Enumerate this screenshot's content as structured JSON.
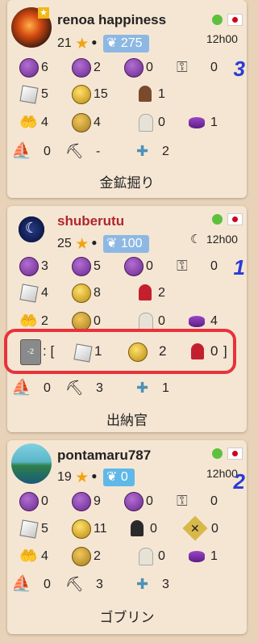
{
  "players": [
    {
      "name": "renoa happiness",
      "score": "21",
      "rank": "275",
      "clock": "12h00",
      "number": "3",
      "avatar": "fire-avatar",
      "rank_color": "#8db8e3",
      "resources": {
        "row1": [
          "6",
          "2",
          "0",
          "0"
        ],
        "row2": [
          "5",
          "15",
          "1"
        ],
        "row3": [
          "4",
          "4",
          "0",
          "1"
        ],
        "row4": [
          "0",
          "-",
          "2"
        ]
      },
      "role": "金鉱掘り"
    },
    {
      "name": "shuberutu",
      "score": "25",
      "rank": "100",
      "clock": "12h00",
      "number": "1",
      "avatar": "moon-avatar",
      "rank_color": "#8db8e3",
      "resources": {
        "row1": [
          "3",
          "5",
          "0",
          "0"
        ],
        "row2": [
          "4",
          "8",
          "2"
        ],
        "row3": [
          "2",
          "0",
          "0",
          "4"
        ],
        "row4": [
          "0",
          "3",
          "1"
        ]
      },
      "role": "出納官"
    },
    {
      "name": "pontamaru787",
      "score": "19",
      "rank": "0",
      "clock": "12h00",
      "number": "2",
      "avatar": "island-avatar",
      "rank_color": "#5fb8e8",
      "resources": {
        "row1": [
          "0",
          "9",
          "0",
          "0"
        ],
        "row2": [
          "5",
          "11",
          "0",
          "0"
        ],
        "row3": [
          "4",
          "2",
          "0",
          "1"
        ],
        "row4": [
          "0",
          "3",
          "3"
        ]
      },
      "role": "ゴブリン"
    }
  ],
  "highlight": {
    "tile_label": "-2",
    "open": ": [",
    "cube_value": "1",
    "coin_value": "2",
    "meeple_value": "0",
    "close": "]"
  },
  "colors": {
    "background": "#e8d3b8",
    "panel": "#f5e6d3",
    "highlight_border": "#e8323a",
    "player_name_red": "#b0252e",
    "player_number": "#2c3bd6"
  }
}
